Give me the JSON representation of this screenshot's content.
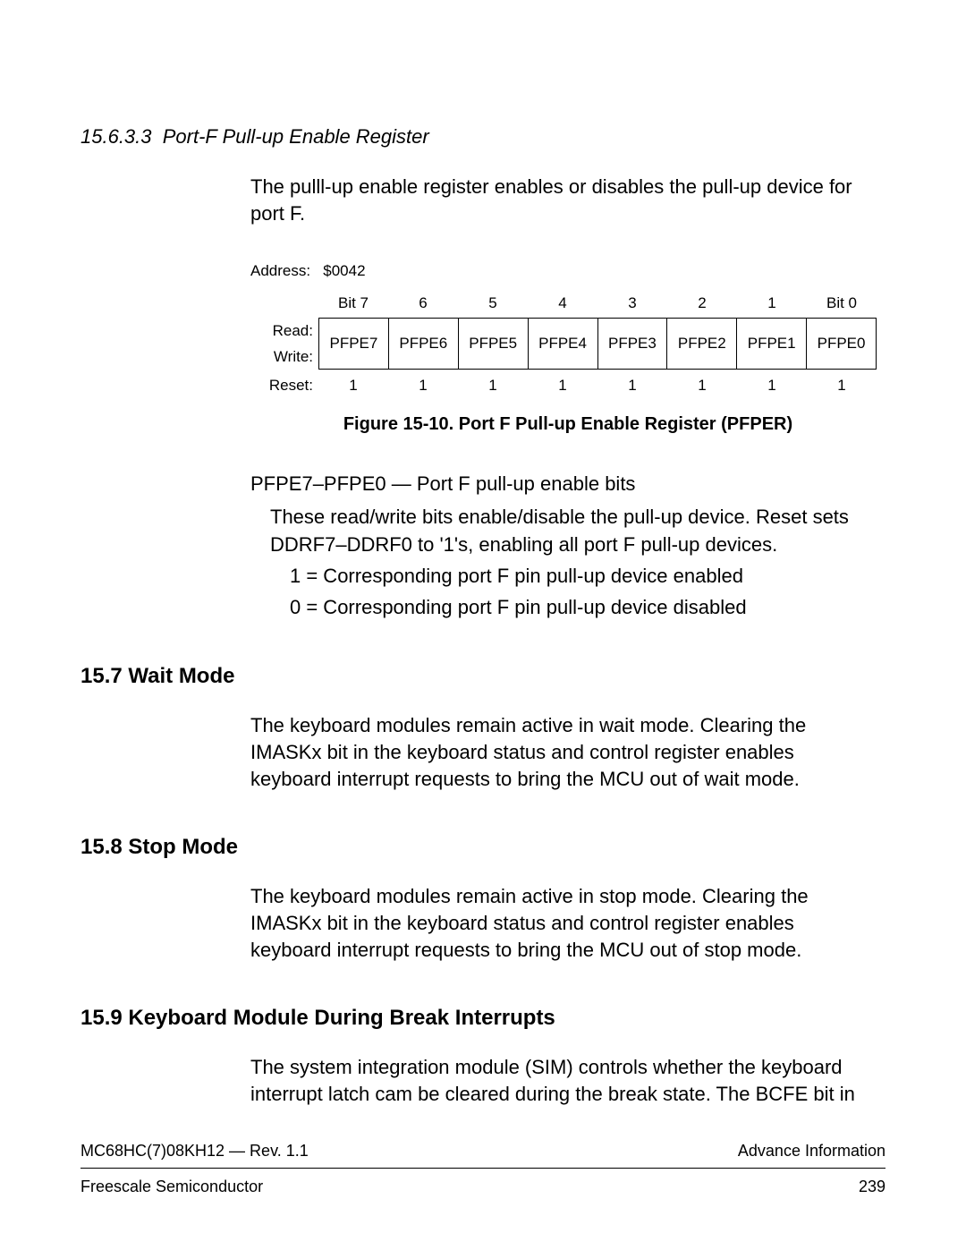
{
  "subsection": {
    "number": "15.6.3.3",
    "title": "Port-F Pull-up Enable Register"
  },
  "intro": "The pulll-up enable register enables or disables the pull-up device for port F.",
  "register": {
    "address_label": "Address:",
    "address_value": "$0042",
    "bit_headers": [
      "Bit 7",
      "6",
      "5",
      "4",
      "3",
      "2",
      "1",
      "Bit 0"
    ],
    "read_label": "Read:",
    "write_label": "Write:",
    "bits": [
      "PFPE7",
      "PFPE6",
      "PFPE5",
      "PFPE4",
      "PFPE3",
      "PFPE2",
      "PFPE1",
      "PFPE0"
    ],
    "reset_label": "Reset:",
    "reset_values": [
      "1",
      "1",
      "1",
      "1",
      "1",
      "1",
      "1",
      "1"
    ]
  },
  "figure_caption": "Figure 15-10. Port F Pull-up Enable Register (PFPER)",
  "description": {
    "title": "PFPE7–PFPE0 — Port F pull-up enable bits",
    "line1": "These read/write bits enable/disable the pull-up device. Reset sets DDRF7–DDRF0 to '1's, enabling all port F pull-up devices.",
    "opt1": "1 = Corresponding port F pin pull-up device enabled",
    "opt0": "0 = Corresponding port F pin pull-up device disabled"
  },
  "sections": {
    "s1": {
      "title": "15.7  Wait Mode",
      "body": "The keyboard modules remain active in wait mode. Clearing the IMASKx bit in the keyboard status and control register enables keyboard interrupt requests to bring the MCU out of wait mode."
    },
    "s2": {
      "title": "15.8  Stop Mode",
      "body": "The keyboard modules remain active in stop mode. Clearing the IMASKx bit in the keyboard status and control register enables keyboard interrupt requests to bring the MCU out of stop mode."
    },
    "s3": {
      "title": "15.9  Keyboard Module During Break Interrupts",
      "body": "The system integration module (SIM) controls whether the keyboard interrupt latch cam be cleared during the break state. The BCFE bit in"
    }
  },
  "footer": {
    "doc_id": "MC68HC(7)08KH12 — Rev. 1.1",
    "right_top": "Advance Information",
    "left_bottom": "Freescale Semiconductor",
    "page_number": "239"
  }
}
